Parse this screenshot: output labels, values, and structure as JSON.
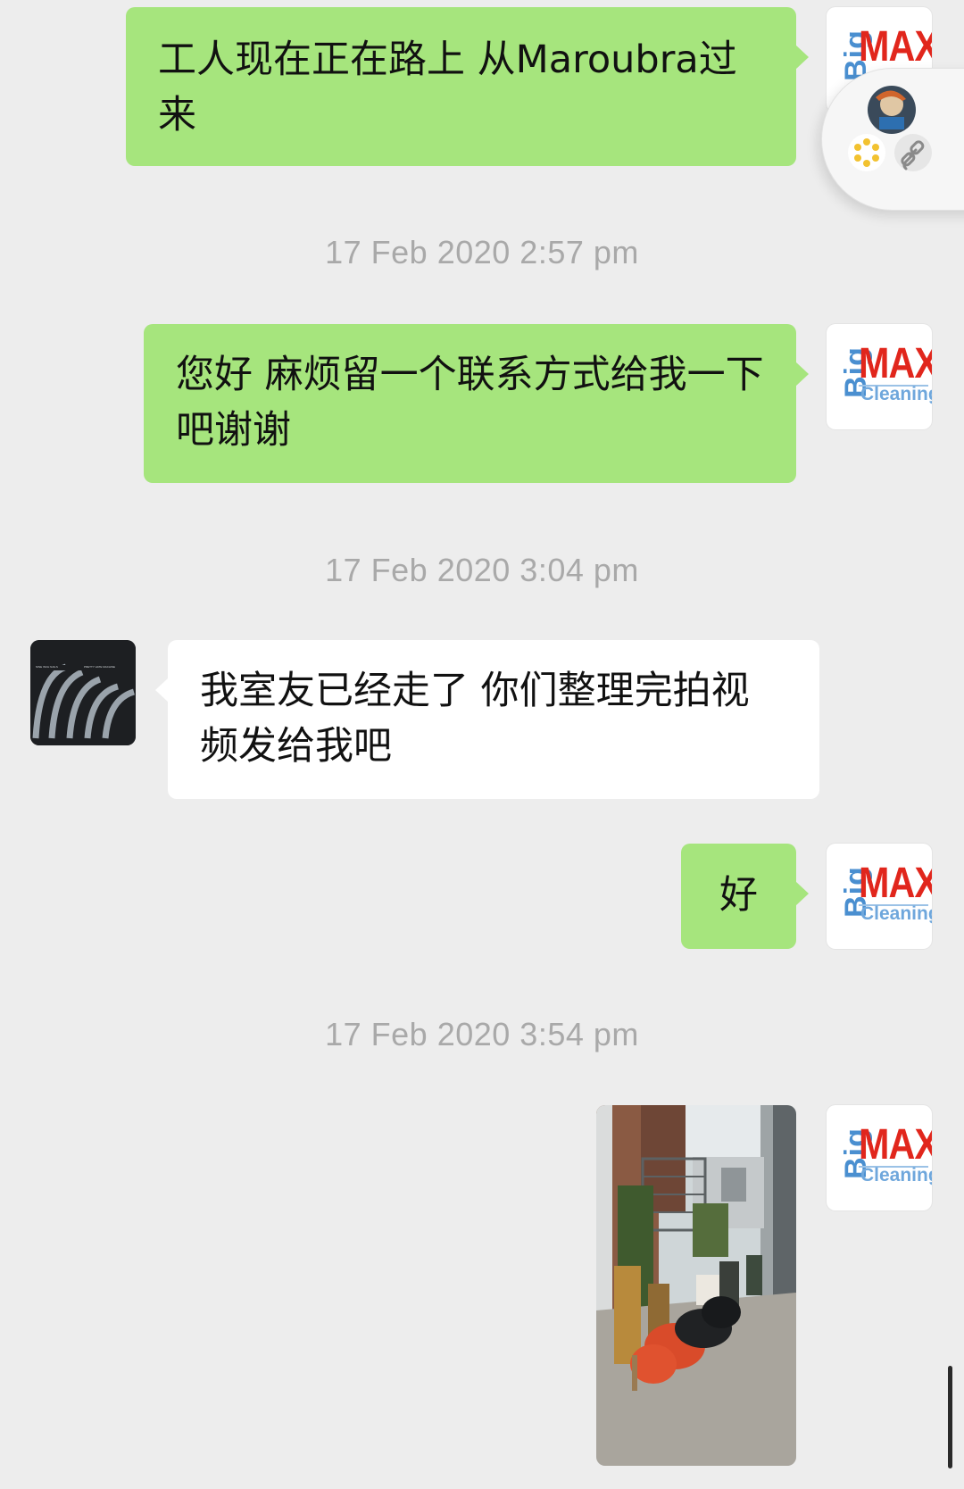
{
  "messages": [
    {
      "type": "outgoing",
      "text": "工人现在正在路上 从Maroubra过来"
    },
    {
      "type": "timestamp",
      "text": "17 Feb 2020 2:57 pm"
    },
    {
      "type": "outgoing",
      "text": "您好 麻烦留一个联系方式给我一下吧谢谢"
    },
    {
      "type": "timestamp",
      "text": "17 Feb 2020 3:04 pm"
    },
    {
      "type": "incoming",
      "text": "我室友已经走了 你们整理完拍视频发给我吧"
    },
    {
      "type": "outgoing",
      "text": "好"
    },
    {
      "type": "timestamp",
      "text": "17 Feb 2020 3:54 pm"
    },
    {
      "type": "outgoing-image",
      "alt": "photo of a narrow laneway with discarded furniture and rubbish bags"
    }
  ],
  "sender_avatar": {
    "big": "Big",
    "max": "MAX",
    "cleaning": "Cleaning"
  },
  "receiver_avatar": {
    "caption_left": "NINE INCH NAILS",
    "caption_right": "PRETTY HATE MACHINE"
  },
  "colors": {
    "outgoing_bubble": "#a6e57d",
    "incoming_bubble": "#ffffff",
    "background": "#ededed",
    "timestamp": "#a9a9a9"
  },
  "icons": {
    "floating_window": [
      "avatar-icon",
      "app-badge-icon",
      "link-icon"
    ]
  }
}
